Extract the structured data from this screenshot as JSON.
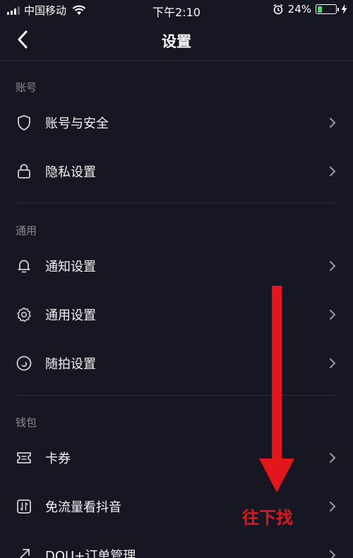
{
  "status_bar": {
    "carrier": "中国移动",
    "time": "下午2:10",
    "battery_percent": "24%",
    "battery_level": 0.24,
    "battery_color": "#4cd964"
  },
  "nav": {
    "title": "设置",
    "back_icon": "chevron-left-icon"
  },
  "sections": [
    {
      "header": "账号",
      "items": [
        {
          "label": "账号与安全",
          "icon": "shield-icon"
        },
        {
          "label": "隐私设置",
          "icon": "lock-icon"
        }
      ]
    },
    {
      "header": "通用",
      "items": [
        {
          "label": "通知设置",
          "icon": "bell-icon"
        },
        {
          "label": "通用设置",
          "icon": "gear-icon"
        },
        {
          "label": "随拍设置",
          "icon": "camera-circle-icon"
        }
      ]
    },
    {
      "header": "钱包",
      "items": [
        {
          "label": "卡券",
          "icon": "ticket-icon"
        },
        {
          "label": "免流量看抖音",
          "icon": "data-transfer-icon"
        },
        {
          "label": "DOU+订单管理",
          "icon": "trend-arrow-icon"
        }
      ]
    }
  ],
  "annotation": {
    "text": "往下找",
    "color": "#e3161b"
  },
  "colors": {
    "background": "#161722",
    "divider": "#2a2b36",
    "section_header": "#8a8b93"
  }
}
